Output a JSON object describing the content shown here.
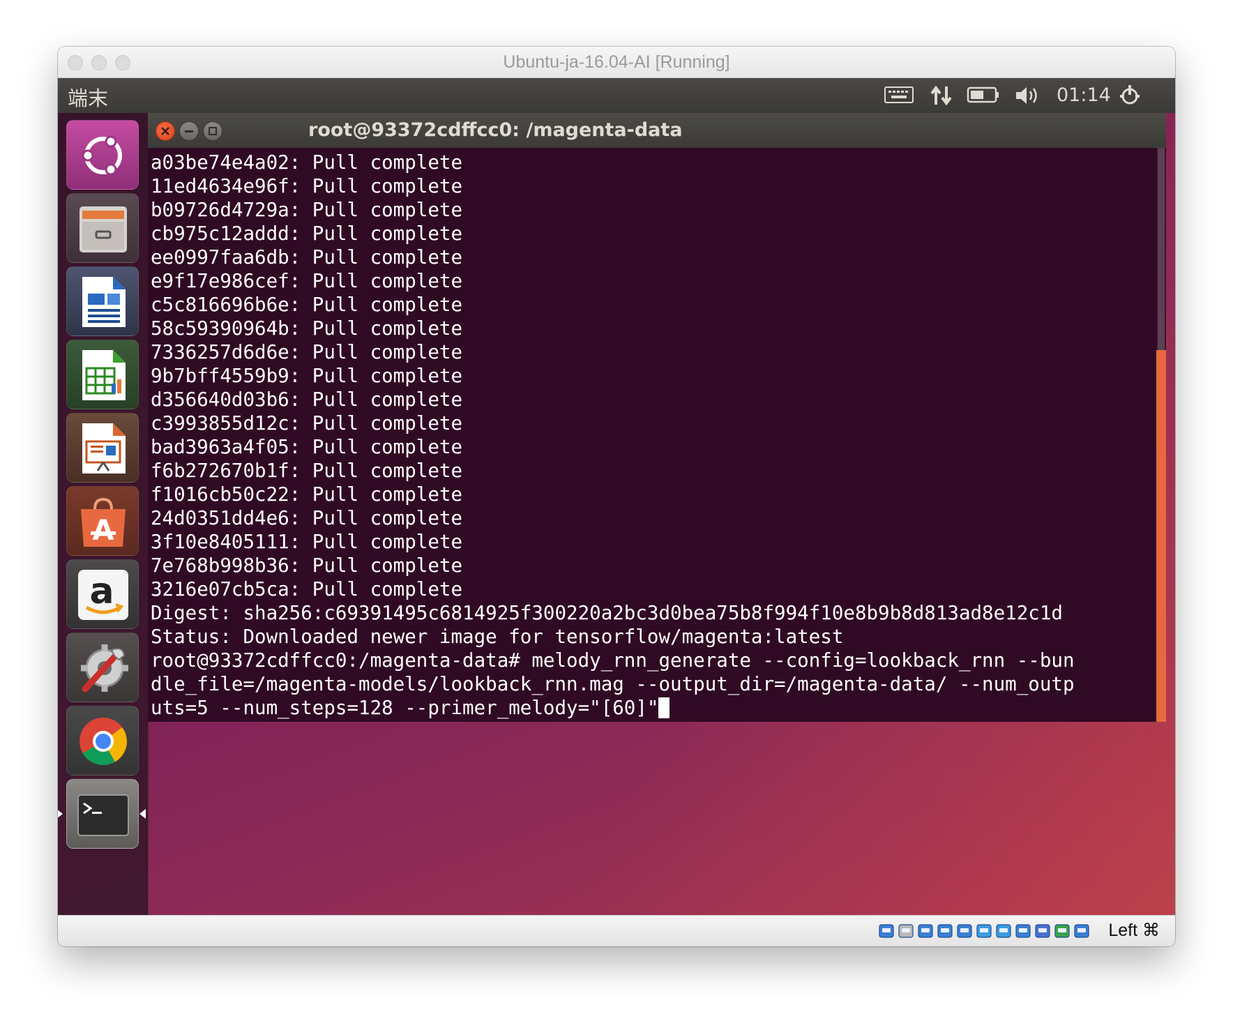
{
  "window": {
    "title": "Ubuntu-ja-16.04-AI [Running]"
  },
  "topbar": {
    "app_name": "端末",
    "clock": "01:14",
    "indicators": [
      "keyboard-icon",
      "network-icon",
      "battery-icon",
      "volume-icon",
      "power-icon"
    ]
  },
  "launcher": {
    "items": [
      "ubuntu-dash-icon",
      "files-icon",
      "writer-icon",
      "calc-icon",
      "impress-icon",
      "software-center-icon",
      "amazon-icon",
      "system-settings-icon",
      "chrome-icon",
      "terminal-icon"
    ],
    "active_index": 9
  },
  "terminal": {
    "title": "root@93372cdffcc0: /magenta-data",
    "lines": [
      "a03be74e4a02: Pull complete",
      "11ed4634e96f: Pull complete",
      "b09726d4729a: Pull complete",
      "cb975c12addd: Pull complete",
      "ee0997faa6db: Pull complete",
      "e9f17e986cef: Pull complete",
      "c5c816696b6e: Pull complete",
      "58c59390964b: Pull complete",
      "7336257d6d6e: Pull complete",
      "9b7bff4559b9: Pull complete",
      "d356640d03b6: Pull complete",
      "c3993855d12c: Pull complete",
      "bad3963a4f05: Pull complete",
      "f6b272670b1f: Pull complete",
      "f1016cb50c22: Pull complete",
      "24d0351dd4e6: Pull complete",
      "3f10e8405111: Pull complete",
      "7e768b998b36: Pull complete",
      "3216e07cb5ca: Pull complete",
      "Digest: sha256:c69391495c6814925f300220a2bc3d0bea75b8f994f10e8b9b8d813ad8e12c1d",
      "Status: Downloaded newer image for tensorflow/magenta:latest",
      "root@93372cdffcc0:/magenta-data# melody_rnn_generate --config=lookback_rnn --bun",
      "dle_file=/magenta-models/lookback_rnn.mag --output_dir=/magenta-data/ --num_outp"
    ],
    "last_line": "uts=5 --num_steps=128 --primer_melody=\"[60]\"",
    "background": "#300a24",
    "scroll_position": 1.0
  },
  "statusbar": {
    "icons": [
      "hdd-icon",
      "optical-icon",
      "usb-icon",
      "shared-folders-icon",
      "display-icon",
      "network1-icon",
      "network2-icon",
      "network3-icon",
      "cpu-icon",
      "guest-additions-icon",
      "download-icon"
    ],
    "host_key": "Left ⌘"
  },
  "colors": {
    "accent": "#e8693f",
    "ubuntu_aubergine": "#300a24"
  }
}
